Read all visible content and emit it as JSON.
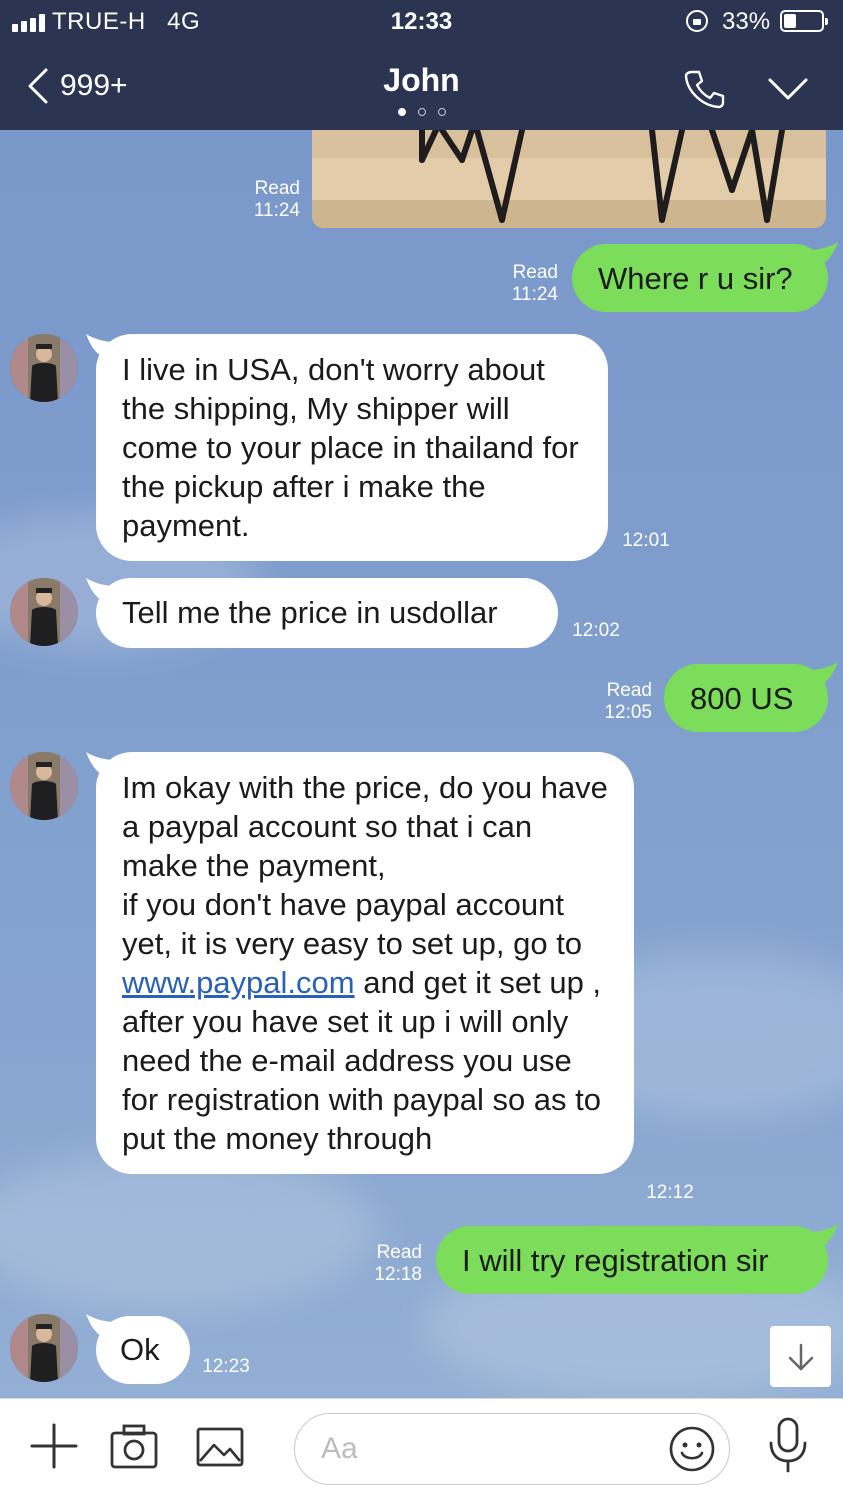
{
  "status_bar": {
    "carrier": "TRUE-H",
    "network": "4G",
    "time": "12:33",
    "battery": "33%"
  },
  "header": {
    "back_count": "999+",
    "title": "John"
  },
  "messages": {
    "photo_read": "Read",
    "photo_time": "11:24",
    "m1": {
      "text": "Where r u sir?",
      "read": "Read",
      "time": "11:24"
    },
    "m2": {
      "text": "I live in USA, don't worry about the shipping, My shipper will come to your place in thailand for the pickup after i make the payment.",
      "time": "12:01"
    },
    "m3": {
      "text": "Tell me the price in usdollar",
      "time": "12:02"
    },
    "m4": {
      "text": "800 US",
      "read": "Read",
      "time": "12:05"
    },
    "m5": {
      "text_before_link": "Im okay with the price, do you have a paypal account so that i can make the payment,\nif you don't have paypal account yet, it is very easy to set up, go to ",
      "link": "www.paypal.com",
      "text_after_link": " and get it set up , after you have set it up i will only need the e-mail address you use for registration with paypal so as to put the money through",
      "time": "12:12"
    },
    "m6": {
      "text": "I will try registration sir",
      "read": "Read",
      "time": "12:18"
    },
    "m7": {
      "text": "Ok",
      "time": "12:23"
    }
  },
  "input": {
    "placeholder": "Aa"
  },
  "colors": {
    "header": "#2b3450",
    "outgoing": "#7cdd5a",
    "incoming": "#ffffff",
    "background": "#7f9ccb",
    "link": "#2a61b8"
  },
  "icons": [
    "signal-icon",
    "lock-rotation-icon",
    "battery-icon",
    "back-chevron-icon",
    "phone-icon",
    "chevron-down-icon",
    "arrow-down-icon",
    "plus-icon",
    "camera-icon",
    "image-icon",
    "emoji-icon",
    "microphone-icon"
  ]
}
